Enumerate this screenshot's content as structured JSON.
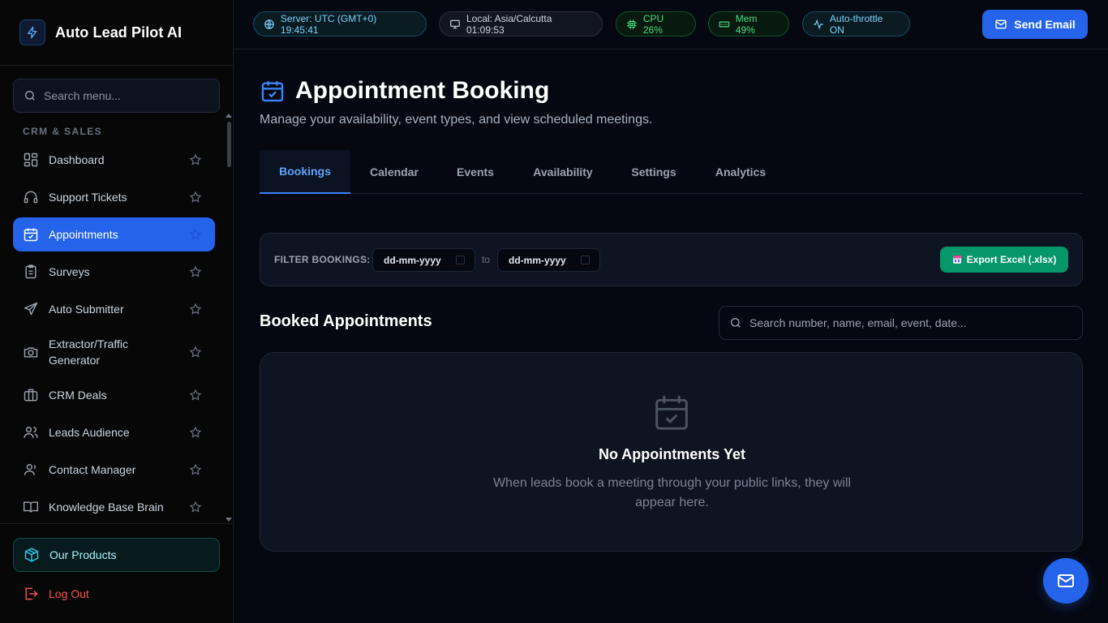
{
  "brand": {
    "title": "Auto Lead Pilot AI"
  },
  "sidebar": {
    "search_placeholder": "Search menu...",
    "section_label": "CRM & SALES",
    "items": [
      {
        "label": "Dashboard",
        "icon": "dashboard-icon"
      },
      {
        "label": "Support Tickets",
        "icon": "headset-icon"
      },
      {
        "label": "Appointments",
        "icon": "calendar-check-icon",
        "active": true
      },
      {
        "label": "Surveys",
        "icon": "clipboard-icon"
      },
      {
        "label": "Auto Submitter",
        "icon": "send-icon"
      },
      {
        "label": "Extractor/Traffic Generator",
        "icon": "camera-icon"
      },
      {
        "label": "CRM Deals",
        "icon": "briefcase-icon"
      },
      {
        "label": "Leads Audience",
        "icon": "users-icon"
      },
      {
        "label": "Contact Manager",
        "icon": "contact-icon"
      },
      {
        "label": "Knowledge Base Brain",
        "icon": "book-icon"
      }
    ],
    "products_label": "Our Products",
    "logout_label": "Log Out"
  },
  "topbar": {
    "server_time": "Server: UTC (GMT+0) 19:45:41",
    "local_time": "Local: Asia/Calcutta 01:09:53",
    "cpu": "CPU 26%",
    "mem": "Mem 49%",
    "throttle": "Auto-throttle ON",
    "send_email_label": "Send Email"
  },
  "page": {
    "title": "Appointment Booking",
    "subtitle": "Manage your availability, event types, and view scheduled meetings.",
    "tabs": [
      "Bookings",
      "Calendar",
      "Events",
      "Availability",
      "Settings",
      "Analytics"
    ],
    "active_tab": "Bookings"
  },
  "filter": {
    "label": "FILTER BOOKINGS:",
    "from_placeholder": "dd-mm-yyyy",
    "to_label": "to",
    "to_placeholder": "dd-mm-yyyy",
    "export_label": "Export Excel (.xlsx)"
  },
  "booked": {
    "title": "Booked Appointments",
    "search_placeholder": "Search number, name, email, event, date...",
    "empty_title": "No Appointments Yet",
    "empty_desc": "When leads book a meeting through your public links, they will appear here."
  },
  "colors": {
    "accent": "#2563eb",
    "export_green": "#059669",
    "logout_red": "#f05252",
    "background": "#050810"
  }
}
